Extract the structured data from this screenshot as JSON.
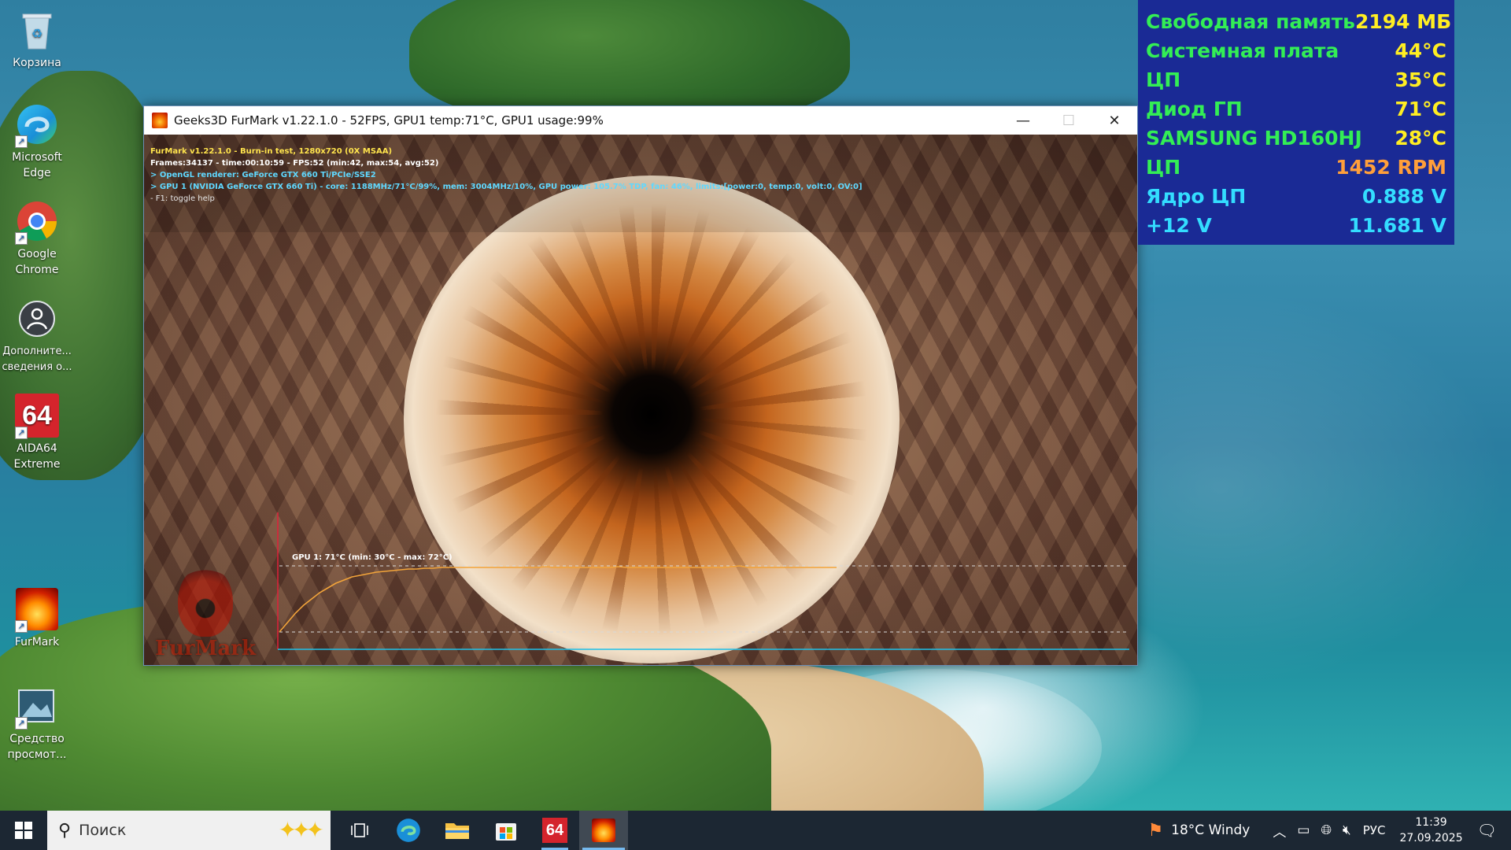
{
  "desktop": {
    "icons": [
      {
        "label": "Корзина",
        "icon": "recycle-bin-icon"
      },
      {
        "label": "Microsoft Edge",
        "icon": "edge-icon"
      },
      {
        "label": "Google Chrome",
        "icon": "chrome-icon"
      },
      {
        "label": "Дополните... сведения о...",
        "icon": "info-icon"
      },
      {
        "label": "AIDA64 Extreme",
        "icon": "aida64-icon",
        "glyph": "64"
      },
      {
        "label": "FurMark",
        "icon": "furmark-icon"
      },
      {
        "label": "Средство просмот...",
        "icon": "viewer-icon"
      }
    ]
  },
  "furmark_window": {
    "title": "Geeks3D FurMark v1.22.1.0 - 52FPS, GPU1 temp:71°C, GPU1 usage:99%",
    "controls": {
      "minimize": "—",
      "maximize": "☐",
      "close": "✕"
    },
    "osd": {
      "line1": "FurMark v1.22.1.0 - Burn-in test, 1280x720 (0X MSAA)",
      "line2": "Frames:34137 - time:00:10:59 - FPS:52 (min:42, max:54, avg:52)",
      "line3": "> OpenGL renderer: GeForce GTX 660 Ti/PCIe/SSE2",
      "line4": "> GPU 1 (NVIDIA GeForce GTX 660 Ti) - core: 1188MHz/71°C/99%, mem: 3004MHz/10%, GPU power: 105.7% TDP, fan: 46%, limits:[power:0, temp:0, volt:0, OV:0]",
      "line5": "- F1: toggle help"
    },
    "logo_text": "FurMark",
    "graph": {
      "label": "GPU 1: 71°C (min: 30°C - max: 72°C)",
      "current": 71,
      "min": 30,
      "max": 72
    }
  },
  "chart_data": {
    "type": "line",
    "title": "GPU 1: 71°C (min: 30°C - max: 72°C)",
    "xlabel": "",
    "ylabel": "",
    "ylim": [
      30,
      72
    ],
    "series": [
      {
        "values": [
          30,
          36,
          42,
          47,
          51,
          55,
          58,
          61,
          63,
          65,
          66,
          67,
          68,
          68.5,
          69,
          69.5,
          70,
          70,
          70.5,
          70.5,
          71,
          71,
          71,
          71,
          71,
          71,
          71,
          71,
          71,
          71,
          71,
          71,
          71,
          71.5,
          71,
          71,
          71,
          71,
          71,
          71,
          71,
          71,
          71.5,
          71,
          71,
          71,
          71,
          71,
          71,
          71,
          71,
          71,
          71,
          71,
          71,
          71,
          71.5,
          72,
          71,
          71,
          71,
          71,
          71,
          71,
          71,
          71,
          71,
          71,
          71,
          71
        ]
      }
    ]
  },
  "sensors": [
    {
      "label": "Свободная память",
      "value": "2194 МБ",
      "value_color": "yellow"
    },
    {
      "label": "Системная плата",
      "value": "44°C",
      "value_color": "yellow"
    },
    {
      "label": "ЦП",
      "value": "35°C",
      "value_color": "yellow"
    },
    {
      "label": "Диод ГП",
      "value": "71°C",
      "value_color": "yellow"
    },
    {
      "label": "SAMSUNG HD160HJ",
      "value": "28°C",
      "value_color": "yellow"
    },
    {
      "label": "ЦП",
      "value": "1452 RPM",
      "value_color": "orange"
    },
    {
      "label": "Ядро ЦП",
      "value": "0.888 V",
      "value_color": "cyan"
    },
    {
      "label": "+12 V",
      "value": "11.681 V",
      "value_color": "cyan"
    }
  ],
  "colors": {
    "sensor_bg": "#1a2a95",
    "sensor_label": "#33ee55",
    "taskbar": "#1c2733",
    "accent": "#76b9ed"
  },
  "taskbar": {
    "search_placeholder": "Поиск",
    "apps": [
      {
        "name": "task-view",
        "icon": "task-view-icon"
      },
      {
        "name": "edge",
        "icon": "edge-icon"
      },
      {
        "name": "file-explorer",
        "icon": "folder-icon"
      },
      {
        "name": "store",
        "icon": "store-icon"
      },
      {
        "name": "aida64",
        "icon": "aida64-icon",
        "glyph": "64"
      },
      {
        "name": "furmark",
        "icon": "furmark-icon"
      }
    ],
    "tray": {
      "weather": "18°C  Windy",
      "language": "РУС",
      "time": "11:39",
      "date": "27.09.2025"
    }
  }
}
